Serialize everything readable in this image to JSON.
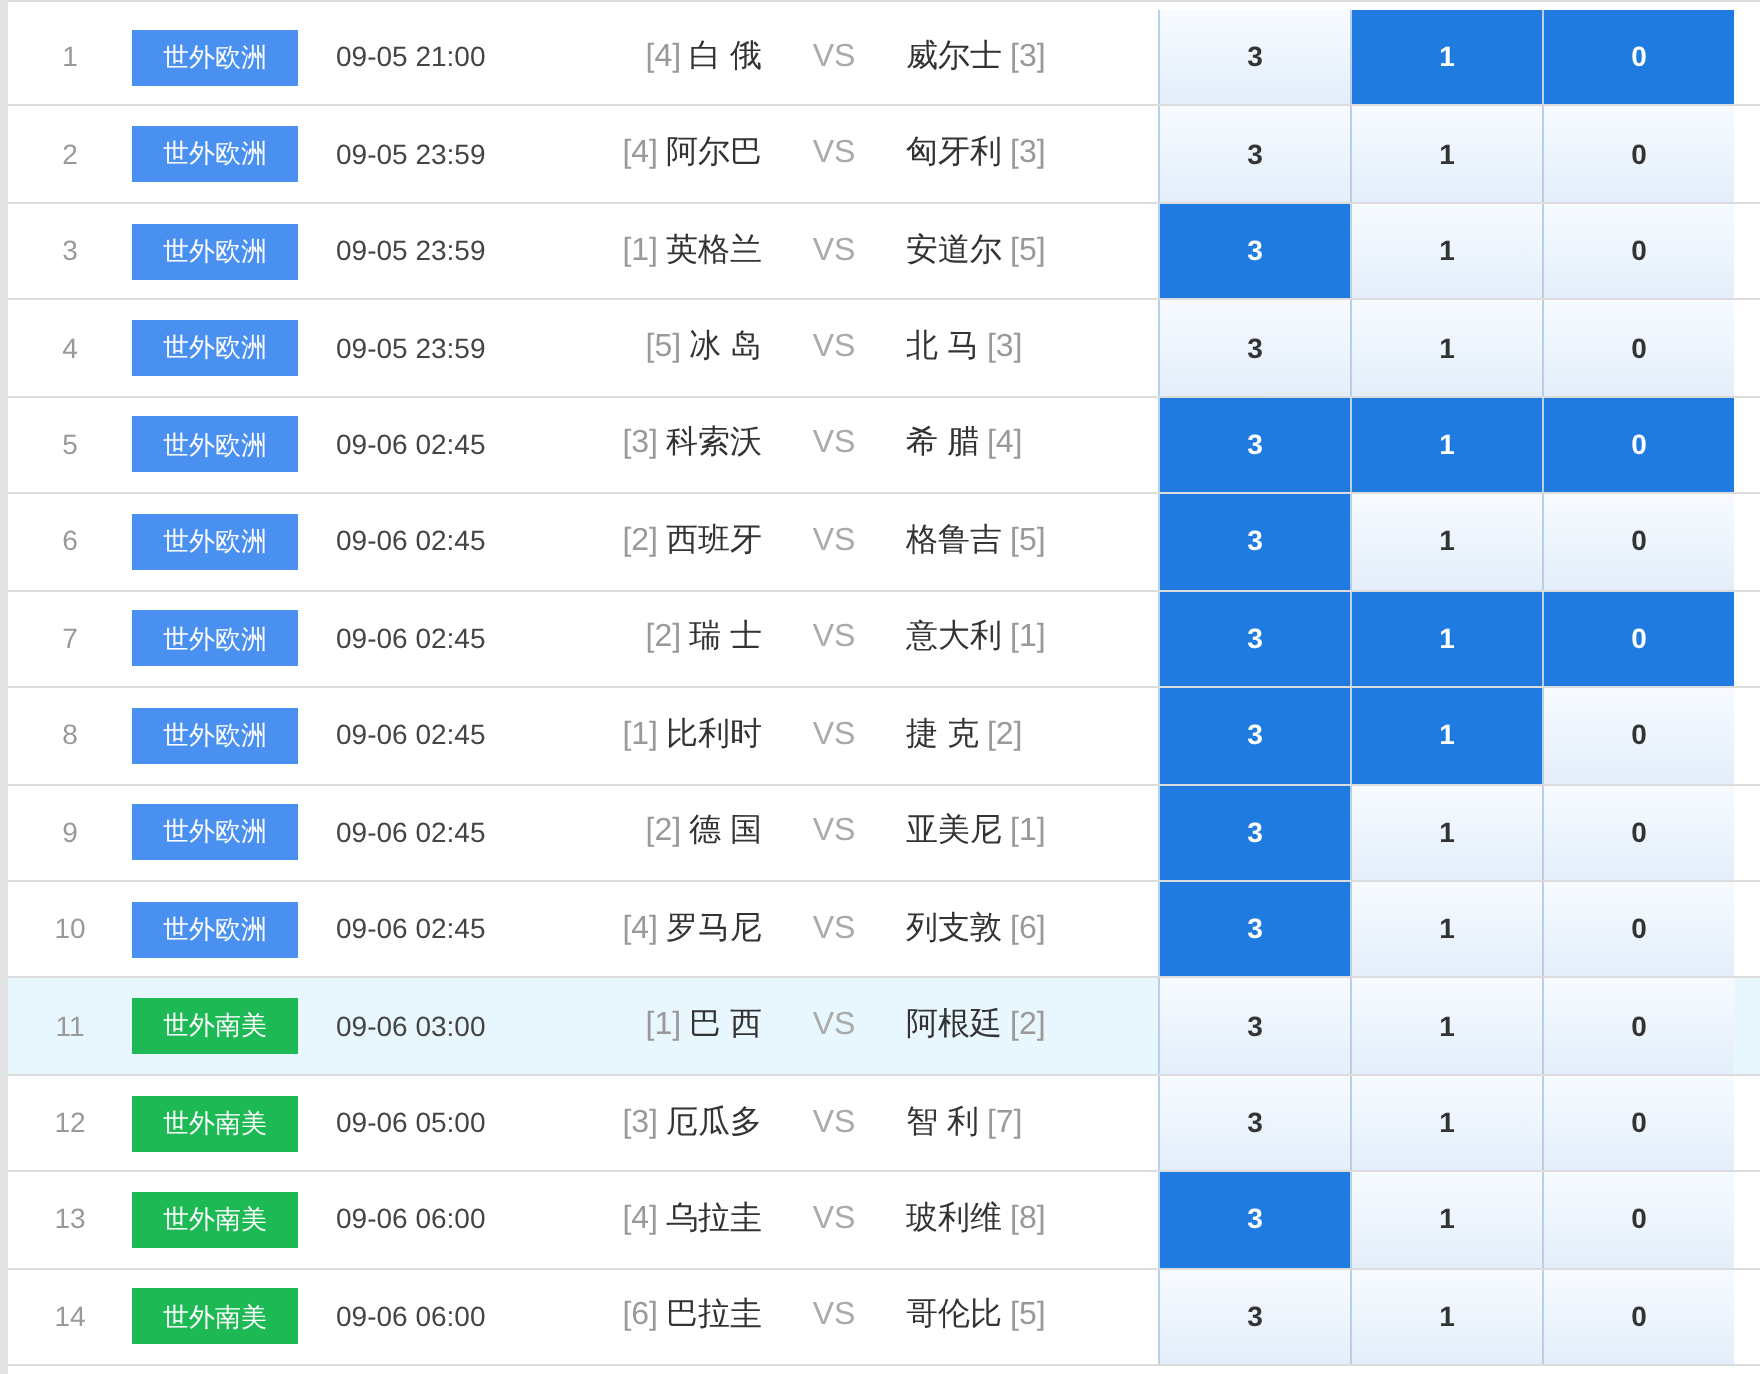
{
  "matches": [
    {
      "index": "1",
      "league": "世外欧洲",
      "color": "#4a90f0",
      "time": "09-05 21:00",
      "home_rank": "[4]",
      "home": "白 俄",
      "vs": "VS",
      "away": "威尔士",
      "away_rank": "[3]",
      "selected": false,
      "options": [
        {
          "label": "3",
          "selected": false
        },
        {
          "label": "1",
          "selected": true
        },
        {
          "label": "0",
          "selected": true
        }
      ]
    },
    {
      "index": "2",
      "league": "世外欧洲",
      "color": "#4a90f0",
      "time": "09-05 23:59",
      "home_rank": "[4]",
      "home": "阿尔巴",
      "vs": "VS",
      "away": "匈牙利",
      "away_rank": "[3]",
      "selected": false,
      "options": [
        {
          "label": "3",
          "selected": false
        },
        {
          "label": "1",
          "selected": false
        },
        {
          "label": "0",
          "selected": false
        }
      ]
    },
    {
      "index": "3",
      "league": "世外欧洲",
      "color": "#4a90f0",
      "time": "09-05 23:59",
      "home_rank": "[1]",
      "home": "英格兰",
      "vs": "VS",
      "away": "安道尔",
      "away_rank": "[5]",
      "selected": false,
      "options": [
        {
          "label": "3",
          "selected": true
        },
        {
          "label": "1",
          "selected": false
        },
        {
          "label": "0",
          "selected": false
        }
      ]
    },
    {
      "index": "4",
      "league": "世外欧洲",
      "color": "#4a90f0",
      "time": "09-05 23:59",
      "home_rank": "[5]",
      "home": "冰 岛",
      "vs": "VS",
      "away": "北 马",
      "away_rank": "[3]",
      "selected": false,
      "options": [
        {
          "label": "3",
          "selected": false
        },
        {
          "label": "1",
          "selected": false
        },
        {
          "label": "0",
          "selected": false
        }
      ]
    },
    {
      "index": "5",
      "league": "世外欧洲",
      "color": "#4a90f0",
      "time": "09-06 02:45",
      "home_rank": "[3]",
      "home": "科索沃",
      "vs": "VS",
      "away": "希 腊",
      "away_rank": "[4]",
      "selected": false,
      "options": [
        {
          "label": "3",
          "selected": true
        },
        {
          "label": "1",
          "selected": true
        },
        {
          "label": "0",
          "selected": true
        }
      ]
    },
    {
      "index": "6",
      "league": "世外欧洲",
      "color": "#4a90f0",
      "time": "09-06 02:45",
      "home_rank": "[2]",
      "home": "西班牙",
      "vs": "VS",
      "away": "格鲁吉",
      "away_rank": "[5]",
      "selected": false,
      "options": [
        {
          "label": "3",
          "selected": true
        },
        {
          "label": "1",
          "selected": false
        },
        {
          "label": "0",
          "selected": false
        }
      ]
    },
    {
      "index": "7",
      "league": "世外欧洲",
      "color": "#4a90f0",
      "time": "09-06 02:45",
      "home_rank": "[2]",
      "home": "瑞 士",
      "vs": "VS",
      "away": "意大利",
      "away_rank": "[1]",
      "selected": false,
      "options": [
        {
          "label": "3",
          "selected": true
        },
        {
          "label": "1",
          "selected": true
        },
        {
          "label": "0",
          "selected": true
        }
      ]
    },
    {
      "index": "8",
      "league": "世外欧洲",
      "color": "#4a90f0",
      "time": "09-06 02:45",
      "home_rank": "[1]",
      "home": "比利时",
      "vs": "VS",
      "away": "捷 克",
      "away_rank": "[2]",
      "selected": false,
      "options": [
        {
          "label": "3",
          "selected": true
        },
        {
          "label": "1",
          "selected": true
        },
        {
          "label": "0",
          "selected": false
        }
      ]
    },
    {
      "index": "9",
      "league": "世外欧洲",
      "color": "#4a90f0",
      "time": "09-06 02:45",
      "home_rank": "[2]",
      "home": "德 国",
      "vs": "VS",
      "away": "亚美尼",
      "away_rank": "[1]",
      "selected": false,
      "options": [
        {
          "label": "3",
          "selected": true
        },
        {
          "label": "1",
          "selected": false
        },
        {
          "label": "0",
          "selected": false
        }
      ]
    },
    {
      "index": "10",
      "league": "世外欧洲",
      "color": "#4a90f0",
      "time": "09-06 02:45",
      "home_rank": "[4]",
      "home": "罗马尼",
      "vs": "VS",
      "away": "列支敦",
      "away_rank": "[6]",
      "selected": false,
      "options": [
        {
          "label": "3",
          "selected": true
        },
        {
          "label": "1",
          "selected": false
        },
        {
          "label": "0",
          "selected": false
        }
      ]
    },
    {
      "index": "11",
      "league": "世外南美",
      "color": "#1db954",
      "time": "09-06 03:00",
      "home_rank": "[1]",
      "home": "巴 西",
      "vs": "VS",
      "away": "阿根廷",
      "away_rank": "[2]",
      "selected": true,
      "options": [
        {
          "label": "3",
          "selected": false
        },
        {
          "label": "1",
          "selected": false
        },
        {
          "label": "0",
          "selected": false
        }
      ]
    },
    {
      "index": "12",
      "league": "世外南美",
      "color": "#1db954",
      "time": "09-06 05:00",
      "home_rank": "[3]",
      "home": "厄瓜多",
      "vs": "VS",
      "away": "智 利",
      "away_rank": "[7]",
      "selected": false,
      "options": [
        {
          "label": "3",
          "selected": false
        },
        {
          "label": "1",
          "selected": false
        },
        {
          "label": "0",
          "selected": false
        }
      ]
    },
    {
      "index": "13",
      "league": "世外南美",
      "color": "#1db954",
      "time": "09-06 06:00",
      "home_rank": "[4]",
      "home": "乌拉圭",
      "vs": "VS",
      "away": "玻利维",
      "away_rank": "[8]",
      "selected": false,
      "options": [
        {
          "label": "3",
          "selected": true
        },
        {
          "label": "1",
          "selected": false
        },
        {
          "label": "0",
          "selected": false
        }
      ]
    },
    {
      "index": "14",
      "league": "世外南美",
      "color": "#1db954",
      "time": "09-06 06:00",
      "home_rank": "[6]",
      "home": "巴拉圭",
      "vs": "VS",
      "away": "哥伦比",
      "away_rank": "[5]",
      "selected": false,
      "options": [
        {
          "label": "3",
          "selected": false
        },
        {
          "label": "1",
          "selected": false
        },
        {
          "label": "0",
          "selected": false
        }
      ]
    }
  ]
}
